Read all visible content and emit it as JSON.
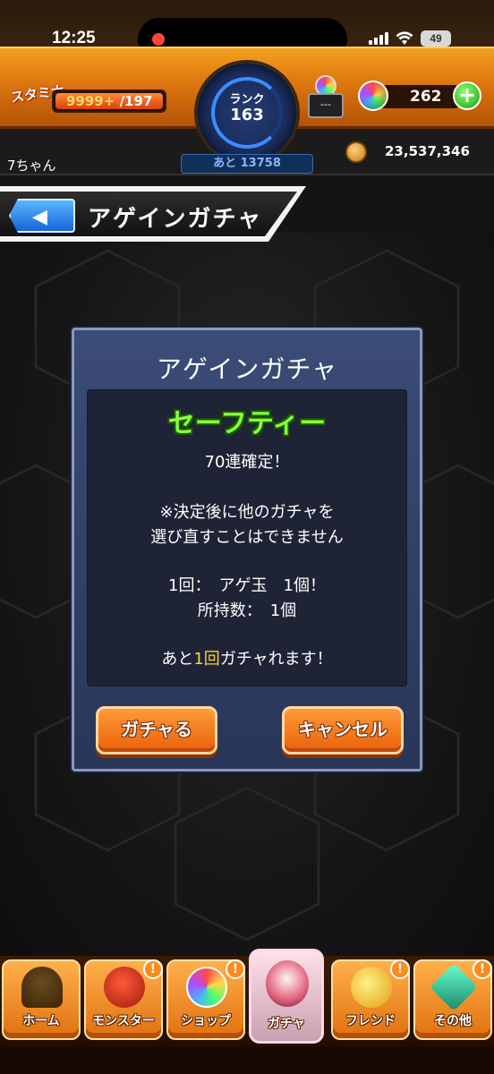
{
  "status_bar": {
    "time": "12:25",
    "battery": "49"
  },
  "hud": {
    "stamina_label": "スタミナ",
    "stamina_current": "9999+",
    "stamina_max": "/197",
    "rank_label": "ランク",
    "rank_value": "163",
    "rank_next": "あと 13758",
    "item_slot": "---",
    "orb_count": "262",
    "coin_count": "23,537,346",
    "player_name": "7ちゃん"
  },
  "header": {
    "title": "アゲインガチャ"
  },
  "dialog": {
    "title": "アゲインガチャ",
    "tag": "セーフティー",
    "line1": "70連確定！",
    "line2": "※決定後に他のガチャを",
    "line3": "選び直すことはできません",
    "line4": "1回：　アゲ玉　1個！",
    "line5": "所持数：　1個",
    "line6_pre": "あと",
    "line6_count": "1回",
    "line6_post": "ガチャれます！",
    "confirm_label": "ガチャる",
    "cancel_label": "キャンセル"
  },
  "nav": {
    "items": [
      {
        "label": "ホーム",
        "icon": "home-icon",
        "badge": ""
      },
      {
        "label": "モンスター",
        "icon": "monster-icon",
        "badge": "!"
      },
      {
        "label": "ショップ",
        "icon": "orb-icon",
        "badge": "!"
      },
      {
        "label": "ガチャ",
        "icon": "gacha-icon",
        "badge": ""
      },
      {
        "label": "フレンド",
        "icon": "friend-icon",
        "badge": "!"
      },
      {
        "label": "その他",
        "icon": "other-icon",
        "badge": "!"
      }
    ]
  },
  "colors": {
    "hud_orange": "#e07a10",
    "dialog_blue": "#3c4c78",
    "button_orange": "#e8600a",
    "safety_green": "#8aff3a",
    "highlight_yellow": "#ffd23a"
  }
}
